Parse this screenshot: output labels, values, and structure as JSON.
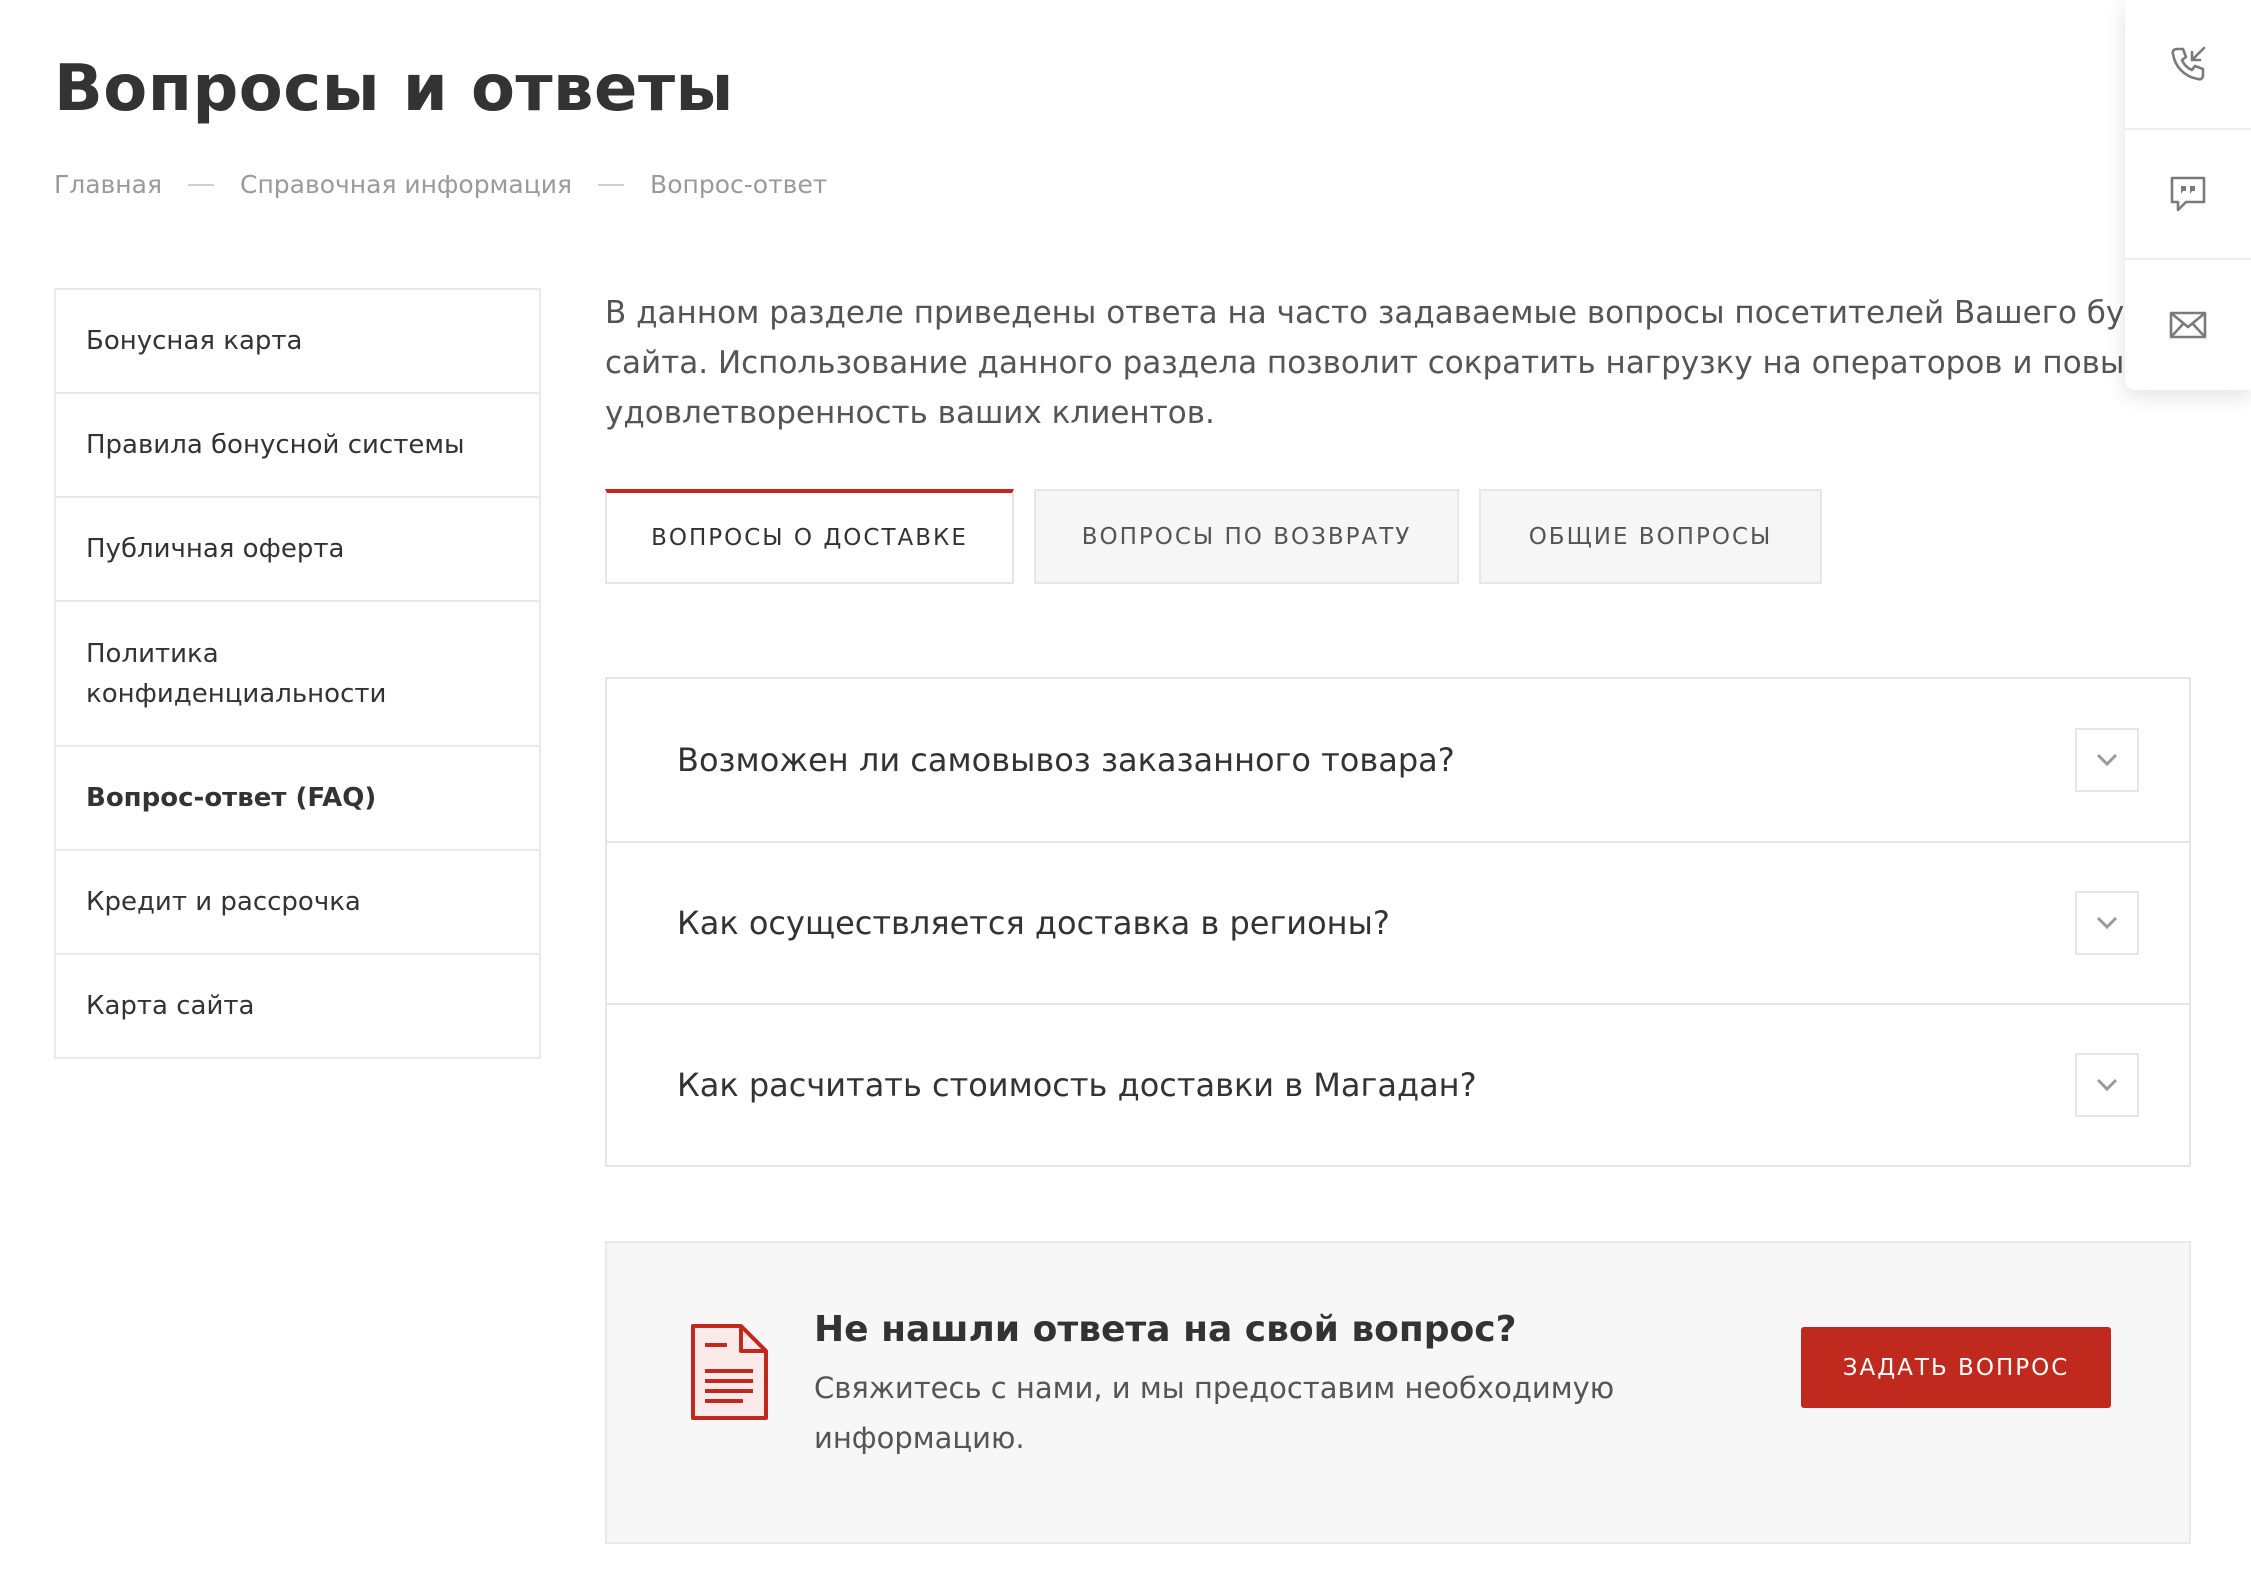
{
  "page": {
    "title": "Вопросы и ответы"
  },
  "breadcrumb": {
    "items": [
      "Главная",
      "Справочная информация",
      "Вопрос-ответ"
    ]
  },
  "sidebar": {
    "items": [
      {
        "label": "Бонусная карта"
      },
      {
        "label": "Правила бонусной системы"
      },
      {
        "label": "Публичная оферта"
      },
      {
        "label": "Политика конфиденциальности"
      },
      {
        "label": "Вопрос-ответ (FAQ)",
        "active": true
      },
      {
        "label": "Кредит и рассрочка"
      },
      {
        "label": "Карта сайта"
      }
    ]
  },
  "intro": {
    "lines": [
      "В данном разделе приведены ответа на часто задаваемые вопросы посетителей Вашего будуще",
      "сайта. Использование данного раздела позволит сократить нагрузку на операторов и повысить",
      "удовлетворенность ваших клиентов."
    ]
  },
  "tabs": [
    {
      "label": "Вопросы о доставке",
      "active": true
    },
    {
      "label": "Вопросы по возврату",
      "active": false
    },
    {
      "label": "Общие вопросы",
      "active": false
    }
  ],
  "faq": {
    "items": [
      {
        "question": "Возможен ли самовывоз заказанного товара?"
      },
      {
        "question": "Как осуществляется доставка в регионы?"
      },
      {
        "question": "Как расчитать стоимость доставки в Магадан?"
      }
    ]
  },
  "cta": {
    "title": "Не нашли ответа на свой вопрос?",
    "text": "Свяжитесь с нами, и мы предоставим необходимую информацию.",
    "button_label": "Задать вопрос",
    "icon": "document-icon"
  },
  "float_panel": {
    "icons": [
      "phone-callback-icon",
      "chat-icon",
      "mail-icon"
    ]
  },
  "colors": {
    "accent": "#c0291e",
    "text": "#333333",
    "muted": "#9a9a9a",
    "border": "#e6e6e6"
  }
}
